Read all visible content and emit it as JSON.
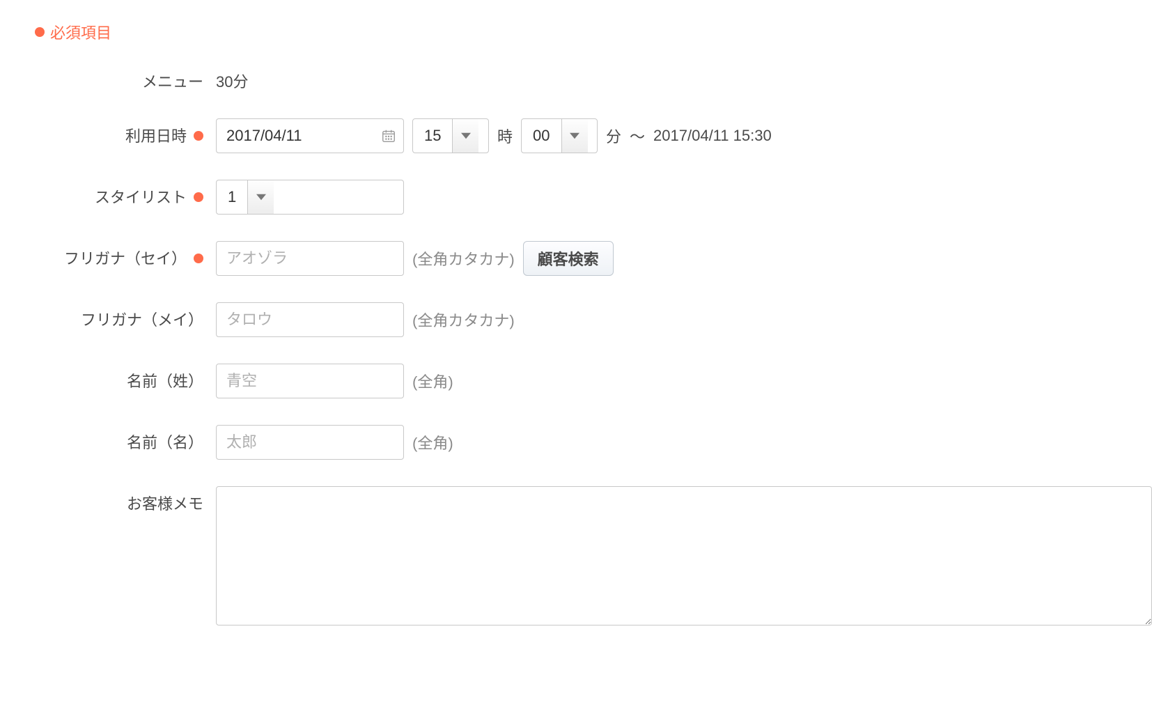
{
  "legend": {
    "label": "必須項目"
  },
  "menu": {
    "label": "メニュー",
    "value": "30分"
  },
  "datetime": {
    "label": "利用日時",
    "date": "2017/04/11",
    "hour": "15",
    "minute": "00",
    "hour_unit": "時",
    "minute_unit": "分",
    "range_sep": "〜",
    "end": "2017/04/11 15:30"
  },
  "stylist": {
    "label": "スタイリスト",
    "value": "1"
  },
  "furigana_sei": {
    "label": "フリガナ（セイ）",
    "placeholder": "アオゾラ",
    "hint": "(全角カタカナ)"
  },
  "furigana_mei": {
    "label": "フリガナ（メイ）",
    "placeholder": "タロウ",
    "hint": "(全角カタカナ)"
  },
  "name_sei": {
    "label": "名前（姓）",
    "placeholder": "青空",
    "hint": "(全角)"
  },
  "name_mei": {
    "label": "名前（名）",
    "placeholder": "太郎",
    "hint": "(全角)"
  },
  "customer_search": {
    "label": "顧客検索"
  },
  "memo": {
    "label": "お客様メモ"
  }
}
